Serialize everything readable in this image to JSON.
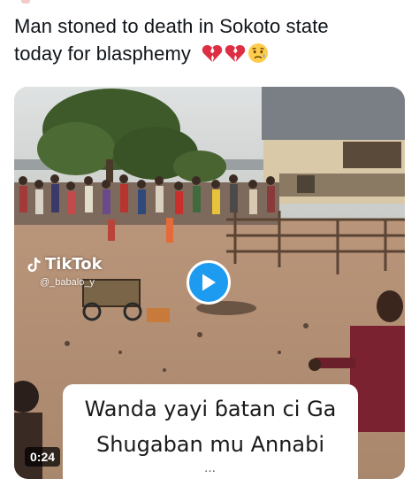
{
  "tweet": {
    "text_line1": "Man stoned to death in Sokoto state",
    "text_line2": "today for blasphemy",
    "emojis": [
      "broken-heart-icon",
      "broken-heart-icon",
      "sad-but-relieved-face-icon"
    ]
  },
  "video": {
    "duration": "0:24",
    "watermark_brand": "TikTok",
    "watermark_handle": "@_babalo_y",
    "caption_line1": "Wanda yayi ɓatan ci Ga",
    "caption_line2": "Shugaban mu Annabi",
    "caption_line3": "…"
  },
  "colors": {
    "play_button": "#1d9bf0",
    "text": "#0f1419"
  }
}
